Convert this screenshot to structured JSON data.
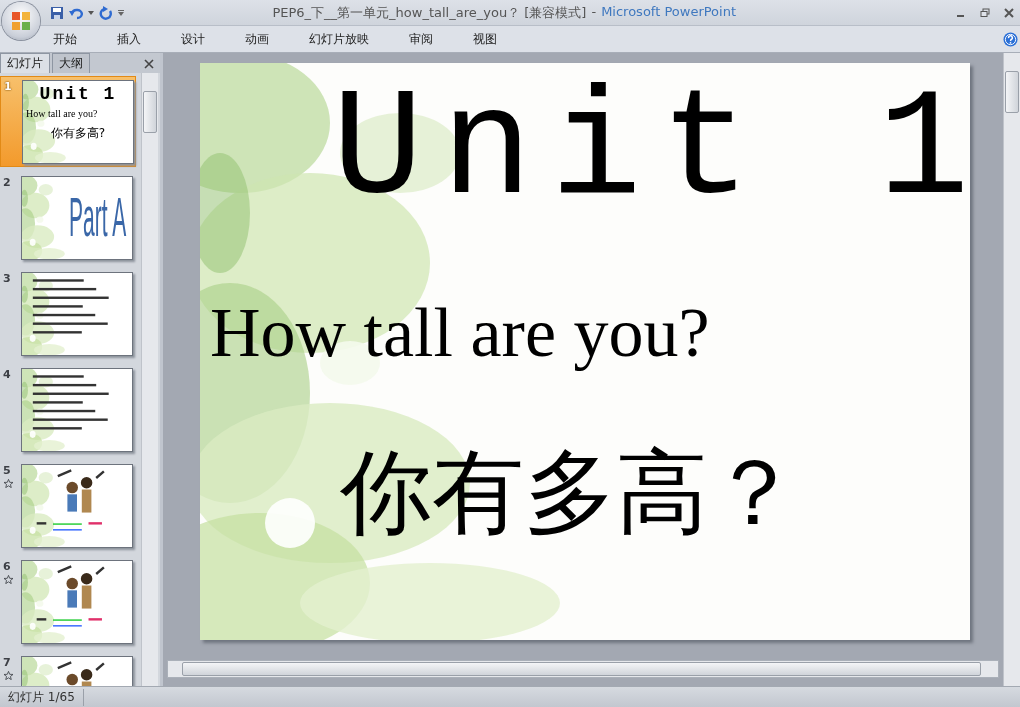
{
  "window": {
    "document_title": "PEP6_下__第一单元_how_tall_are_you？ [兼容模式]",
    "separator": "-",
    "app_name": "Microsoft PowerPoint"
  },
  "ribbon_tabs": [
    "开始",
    "插入",
    "设计",
    "动画",
    "幻灯片放映",
    "审阅",
    "视图"
  ],
  "panel_tabs": [
    {
      "label": "幻灯片",
      "selected": true
    },
    {
      "label": "大纲",
      "selected": false
    }
  ],
  "slides": [
    {
      "number": "1",
      "selected": true,
      "animated": false,
      "kind": "title",
      "lines": [
        "Unit 1",
        "How tall are you?",
        "你有多高?"
      ]
    },
    {
      "number": "2",
      "selected": false,
      "animated": false,
      "kind": "heading",
      "lines": [
        "Part A"
      ]
    },
    {
      "number": "3",
      "selected": false,
      "animated": false,
      "kind": "list"
    },
    {
      "number": "4",
      "selected": false,
      "animated": false,
      "kind": "list"
    },
    {
      "number": "5",
      "selected": false,
      "animated": true,
      "kind": "illustrated"
    },
    {
      "number": "6",
      "selected": false,
      "animated": true,
      "kind": "illustrated"
    },
    {
      "number": "7",
      "selected": false,
      "animated": true,
      "kind": "illustrated"
    }
  ],
  "current_slide": {
    "title": "Unit 1",
    "subtitle": "How tall are you?",
    "chinese": "你有多高？"
  },
  "status_bar": {
    "slide_counter": "幻灯片 1/65"
  }
}
